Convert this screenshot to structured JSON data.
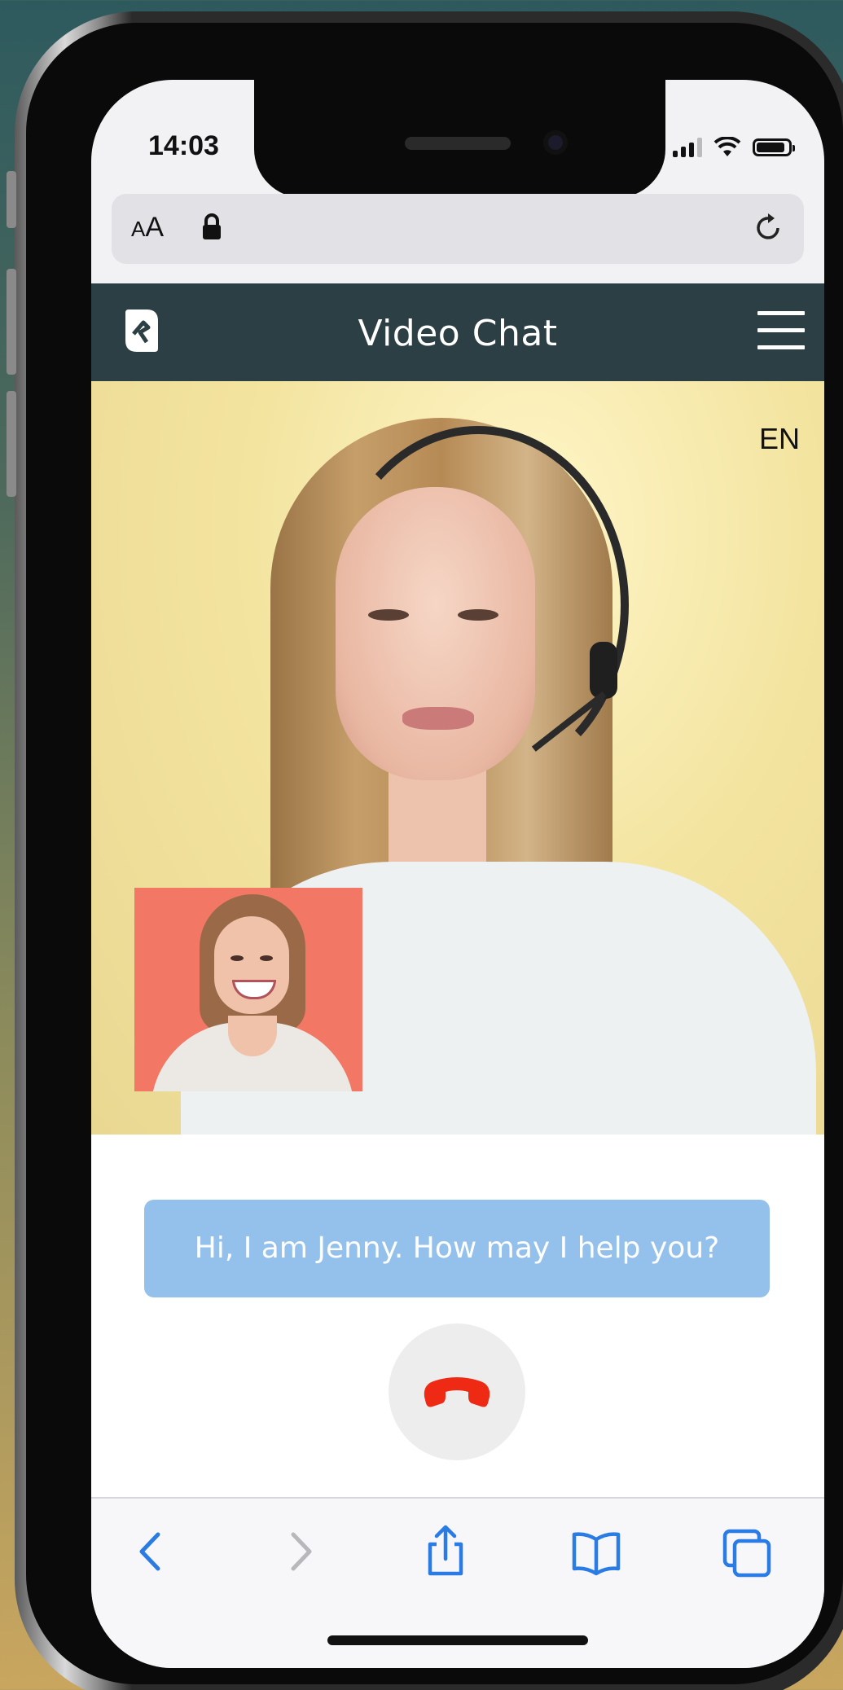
{
  "status_bar": {
    "time": "14:03",
    "icons": [
      "cellular-signal-icon",
      "wifi-icon",
      "battery-icon"
    ]
  },
  "browser": {
    "text_size_label_small": "A",
    "text_size_label_large": "A",
    "icons": [
      "lock-icon",
      "reload-icon"
    ]
  },
  "app_header": {
    "title": "Video Chat",
    "icons": [
      "app-logo-icon",
      "hamburger-menu-icon"
    ],
    "colors": {
      "background": "#2c3f45",
      "text": "#ffffff"
    }
  },
  "video_call": {
    "language": "EN",
    "remote_video": "agent-video",
    "self_view": "self-view-video"
  },
  "chat": {
    "message": "Hi, I am Jenny. How may I help you?",
    "bubble_color": "#94c0ec"
  },
  "controls": {
    "hangup_icon": "phone-hangup-icon",
    "hangup_color": "#ee2a14"
  },
  "safari_toolbar": {
    "icons": [
      "back-icon",
      "forward-icon",
      "share-icon",
      "bookmarks-icon",
      "tabs-icon"
    ],
    "accent_color": "#2a7be4"
  }
}
